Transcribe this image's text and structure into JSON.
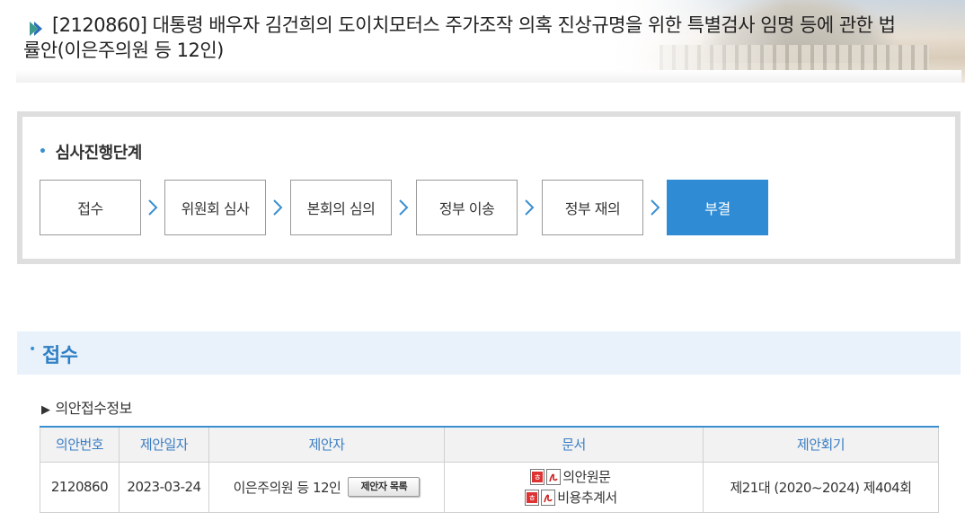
{
  "bill": {
    "title_line1": "[2120860] 대통령 배우자 김건희의 도이치모터스 주가조작 의혹 진상규명을 위한 특별검사 임명 등에 관한 법",
    "title_line2": "률안(이은주의원 등 12인)"
  },
  "review_stage": {
    "heading": "심사진행단계",
    "steps": [
      {
        "label": "접수",
        "active": false
      },
      {
        "label": "위원회 심사",
        "active": false
      },
      {
        "label": "본회의 심의",
        "active": false
      },
      {
        "label": "정부 이송",
        "active": false
      },
      {
        "label": "정부 재의",
        "active": false
      },
      {
        "label": "부결",
        "active": true
      }
    ]
  },
  "reception": {
    "section_title": "접수",
    "subheading": "의안접수정보",
    "table": {
      "headers": [
        "의안번호",
        "제안일자",
        "제안자",
        "문서",
        "제안회기"
      ],
      "row": {
        "bill_no": "2120860",
        "proposal_date": "2023-03-24",
        "proposer": "이은주의원 등 12인",
        "proposer_button": "제안자 목록",
        "documents": [
          "의안원문",
          "비용추계서"
        ],
        "session": "제21대 (2020~2024) 제404회"
      }
    }
  },
  "colors": {
    "accent": "#2e8bd4",
    "section_bg": "#e9f2fb",
    "header_text": "#3a7dc4"
  },
  "icons": [
    "bill-arrow-icon",
    "chevron-right-icon",
    "hwp-file-icon",
    "pdf-file-icon"
  ]
}
